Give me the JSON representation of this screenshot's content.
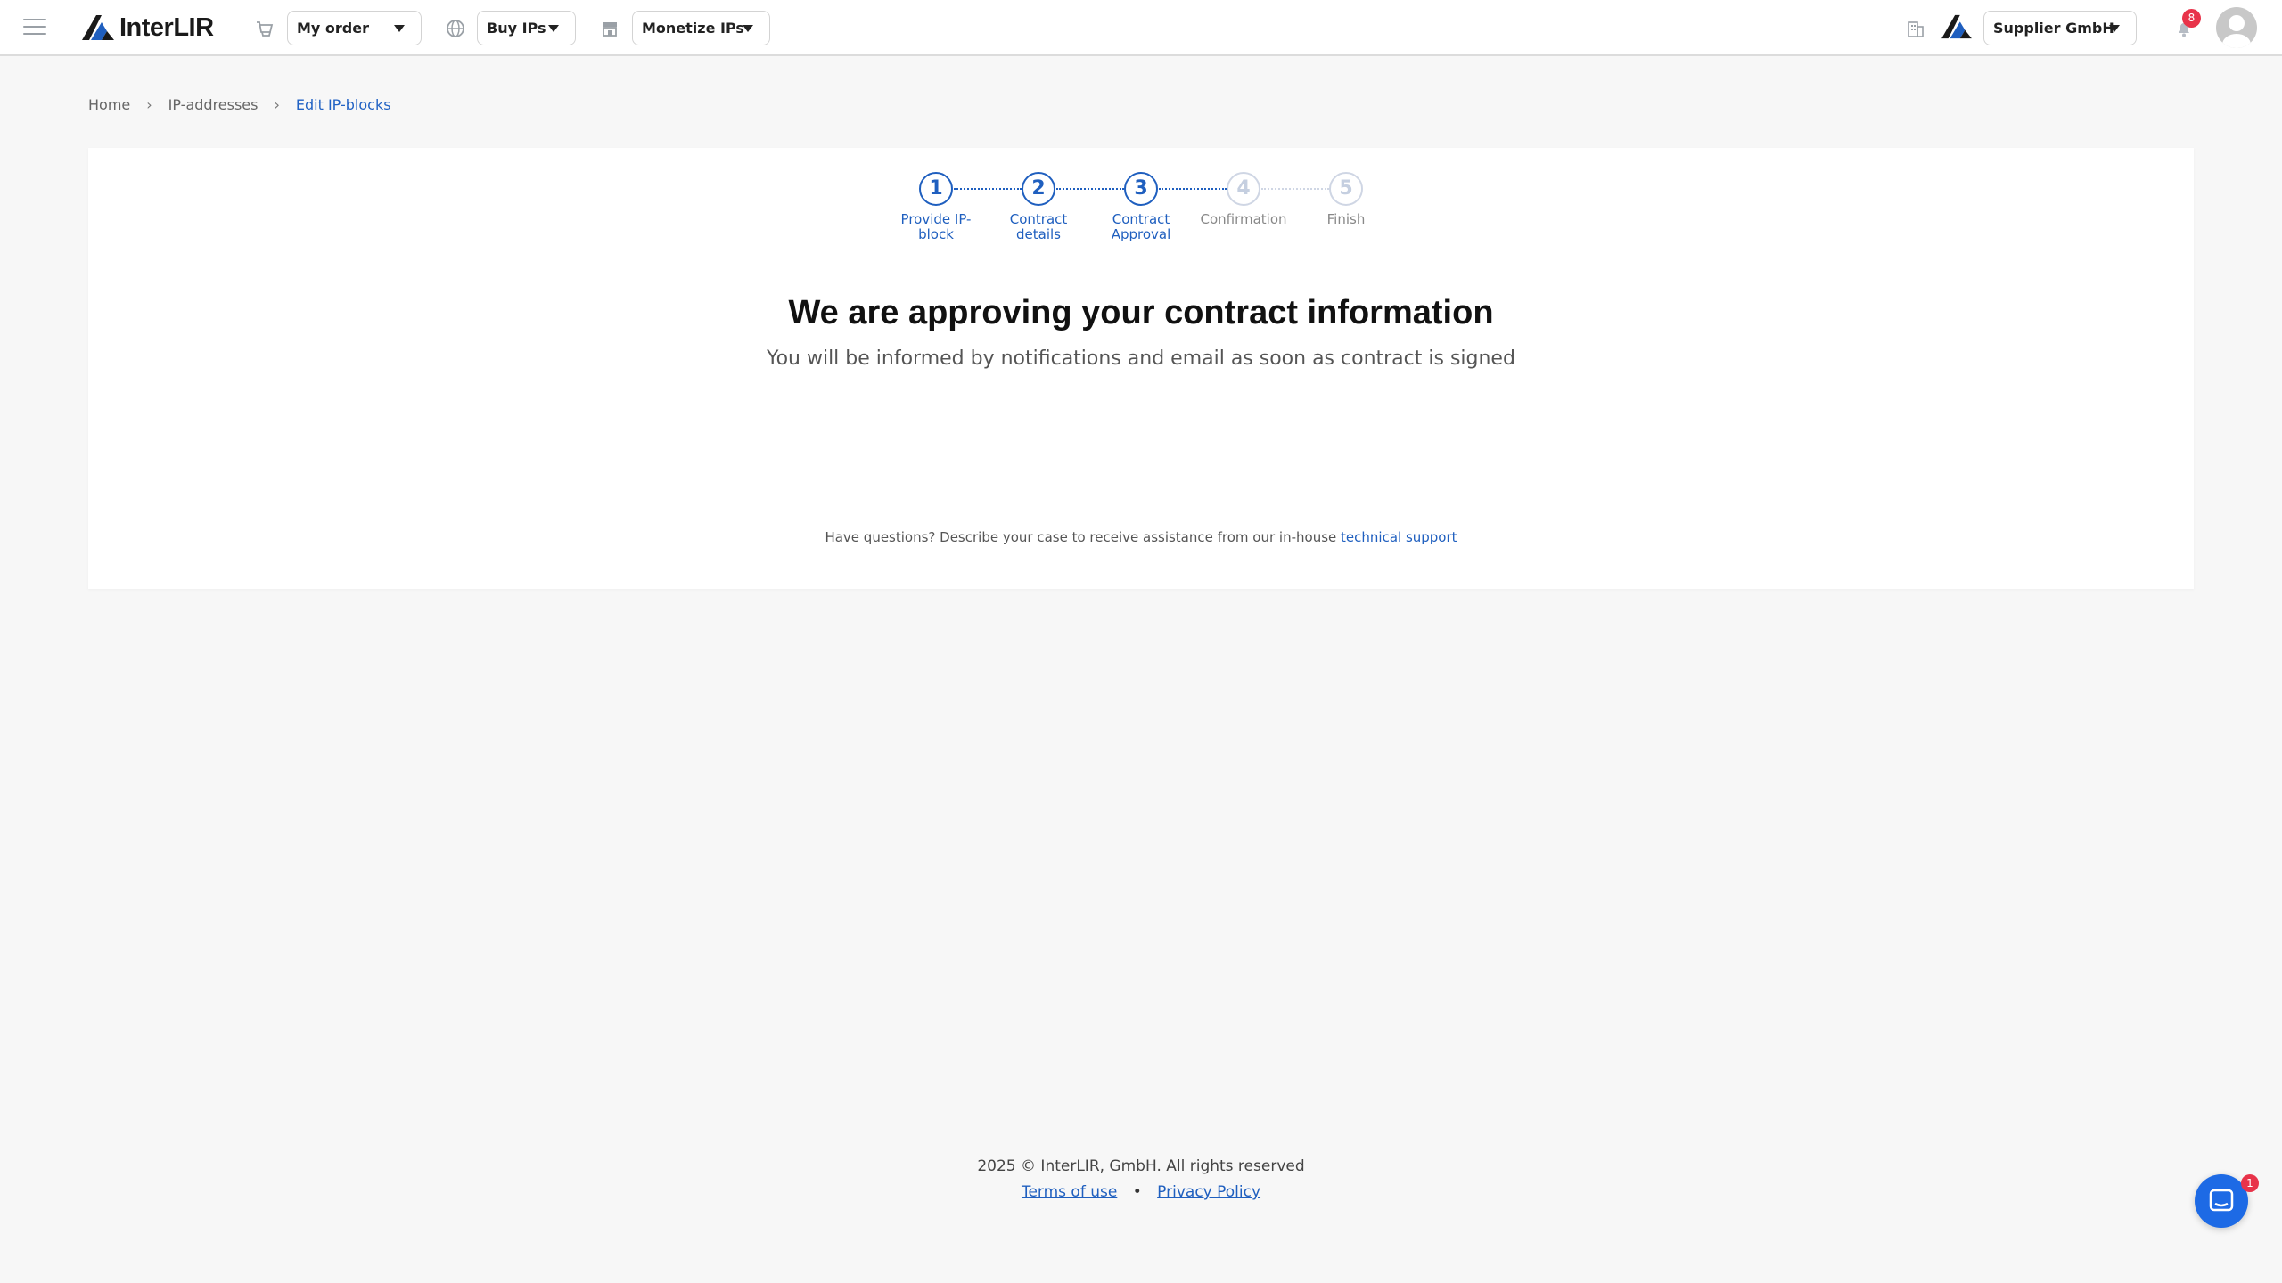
{
  "header": {
    "logo_text": "InterLIR",
    "nav": [
      {
        "label": "My order",
        "icon": "cart-icon"
      },
      {
        "label": "Buy IPs",
        "icon": "globe-icon"
      },
      {
        "label": "Monetize IPs",
        "icon": "store-icon"
      }
    ],
    "company": {
      "label": "Supplier GmbH",
      "icon": "building-icon"
    },
    "notifications_count": "8"
  },
  "breadcrumb": [
    {
      "label": "Home"
    },
    {
      "label": "IP-addresses"
    },
    {
      "label": "Edit IP-blocks"
    }
  ],
  "steps": [
    {
      "number": "1",
      "label": "Provide IP-block",
      "state": "done"
    },
    {
      "number": "2",
      "label": "Contract details",
      "state": "done"
    },
    {
      "number": "3",
      "label": "Contract Approval",
      "state": "active"
    },
    {
      "number": "4",
      "label": "Confirmation",
      "state": "pending"
    },
    {
      "number": "5",
      "label": "Finish",
      "state": "pending"
    }
  ],
  "main": {
    "title": "We are approving your contract information",
    "subtitle": "You will be informed by notifications and email as soon as contract is signed",
    "support_text": "Have questions? Describe your case to receive assistance from our in-house",
    "support_link": "technical support"
  },
  "footer": {
    "copyright": "2025 © InterLIR, GmbH. All rights reserved",
    "terms": "Terms of use",
    "separator": "•",
    "privacy": "Privacy Policy"
  },
  "chat": {
    "badge": "1"
  },
  "colors": {
    "accent": "#1f5fbf",
    "badge": "#e8334a",
    "chat": "#1d6ae5"
  }
}
